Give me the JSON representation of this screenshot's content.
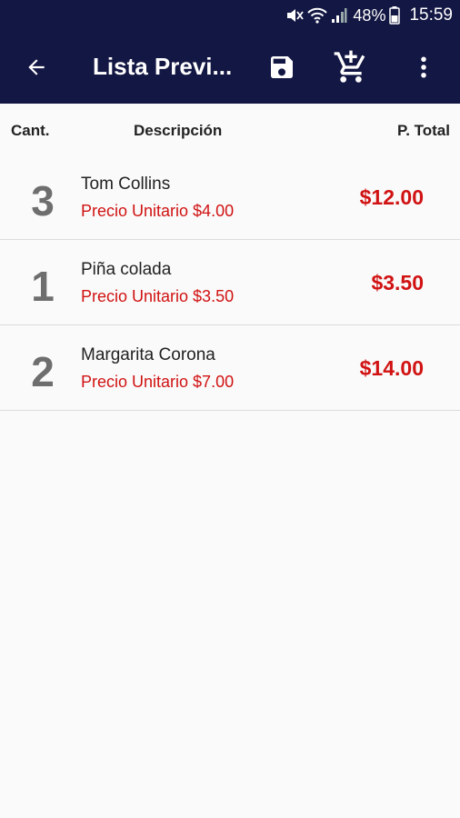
{
  "status_bar": {
    "battery": "48%",
    "time": "15:59"
  },
  "app_bar": {
    "title": "Lista Previ..."
  },
  "columns": {
    "quantity": "Cant.",
    "description": "Descripción",
    "total": "P. Total"
  },
  "items": [
    {
      "quantity": "3",
      "name": "Tom Collins",
      "unit_price": "Precio Unitario $4.00",
      "total": "$12.00"
    },
    {
      "quantity": "1",
      "name": "Piña colada",
      "unit_price": "Precio Unitario $3.50",
      "total": "$3.50"
    },
    {
      "quantity": "2",
      "name": "Margarita Corona",
      "unit_price": "Precio Unitario $7.00",
      "total": "$14.00"
    }
  ],
  "colors": {
    "app_bar": "#131743",
    "accent_red": "#d11212",
    "quantity_gray": "#6e6e6e"
  }
}
